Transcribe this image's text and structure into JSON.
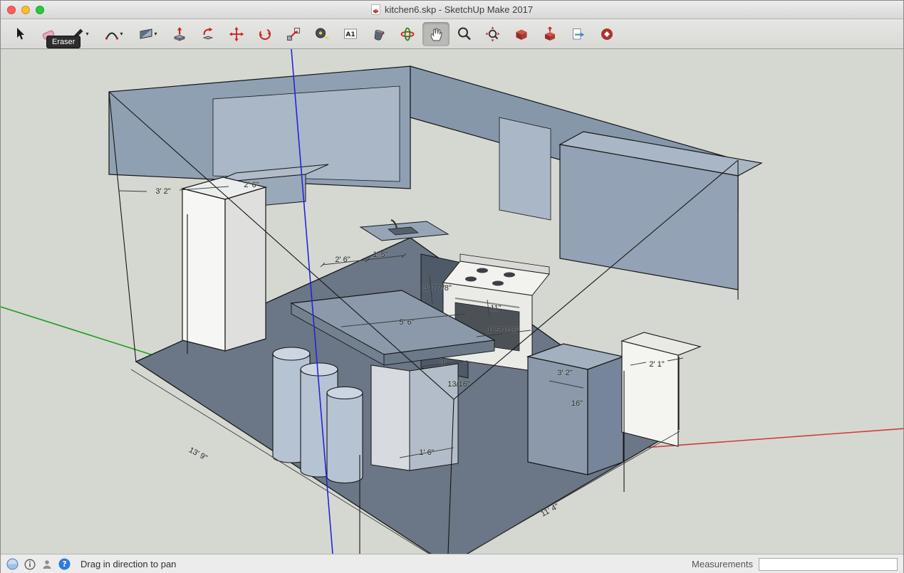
{
  "window": {
    "title": "kitchen6.skp - SketchUp Make 2017"
  },
  "tooltip": {
    "text": "Eraser"
  },
  "toolbar": {
    "active_tool": "Pan",
    "tools": [
      {
        "icon": "select-icon",
        "name": "Select"
      },
      {
        "icon": "eraser-icon",
        "name": "Eraser"
      },
      {
        "icon": "line-icon",
        "name": "Line"
      },
      {
        "icon": "arc-icon",
        "name": "Arcs"
      },
      {
        "icon": "shapes-icon",
        "name": "Shapes"
      },
      {
        "icon": "push-pull-icon",
        "name": "Push/Pull"
      },
      {
        "icon": "follow-me-icon",
        "name": "Follow Me"
      },
      {
        "icon": "move-icon",
        "name": "Move"
      },
      {
        "icon": "rotate-icon",
        "name": "Rotate"
      },
      {
        "icon": "scale-icon",
        "name": "Scale"
      },
      {
        "icon": "tape-measure-icon",
        "name": "Tape Measure"
      },
      {
        "icon": "text-icon",
        "name": "Text"
      },
      {
        "icon": "paint-bucket-icon",
        "name": "Paint Bucket"
      },
      {
        "icon": "orbit-icon",
        "name": "Orbit"
      },
      {
        "icon": "pan-icon",
        "name": "Pan"
      },
      {
        "icon": "zoom-icon",
        "name": "Zoom"
      },
      {
        "icon": "zoom-extents-icon",
        "name": "Zoom Extents"
      },
      {
        "icon": "get-models-icon",
        "name": "Get Models"
      },
      {
        "icon": "share-model-icon",
        "name": "Share Model"
      },
      {
        "icon": "send-to-layout-icon",
        "name": "Send to LayOut"
      },
      {
        "icon": "extension-warehouse-icon",
        "name": "Extension Warehouse"
      }
    ]
  },
  "viewport": {
    "dimension_labels": [
      {
        "text": "3' 2\""
      },
      {
        "text": "2' 6\""
      },
      {
        "text": "2' 6\""
      },
      {
        "text": "1' 5\""
      },
      {
        "text": "3' 7 7/8\""
      },
      {
        "text": "11\""
      },
      {
        "text": "1' 5 1/16\""
      },
      {
        "text": "5' 6\""
      },
      {
        "text": "3'"
      },
      {
        "text": "13/16\""
      },
      {
        "text": "3' 2\""
      },
      {
        "text": "16\""
      },
      {
        "text": "2' 1\""
      },
      {
        "text": "13' 9\""
      },
      {
        "text": "1' 6\""
      },
      {
        "text": "11' 4\""
      }
    ],
    "colors": {
      "background": "#d5d8d1",
      "axis_red": "#d13b3b",
      "axis_green": "#1f9d1f",
      "axis_blue": "#2424dd",
      "wall": "#8fa0b2",
      "floor": "#6b7686"
    }
  },
  "statusbar": {
    "hint": "Drag in direction to pan",
    "measurements_label": "Measurements",
    "measurements_value": ""
  }
}
